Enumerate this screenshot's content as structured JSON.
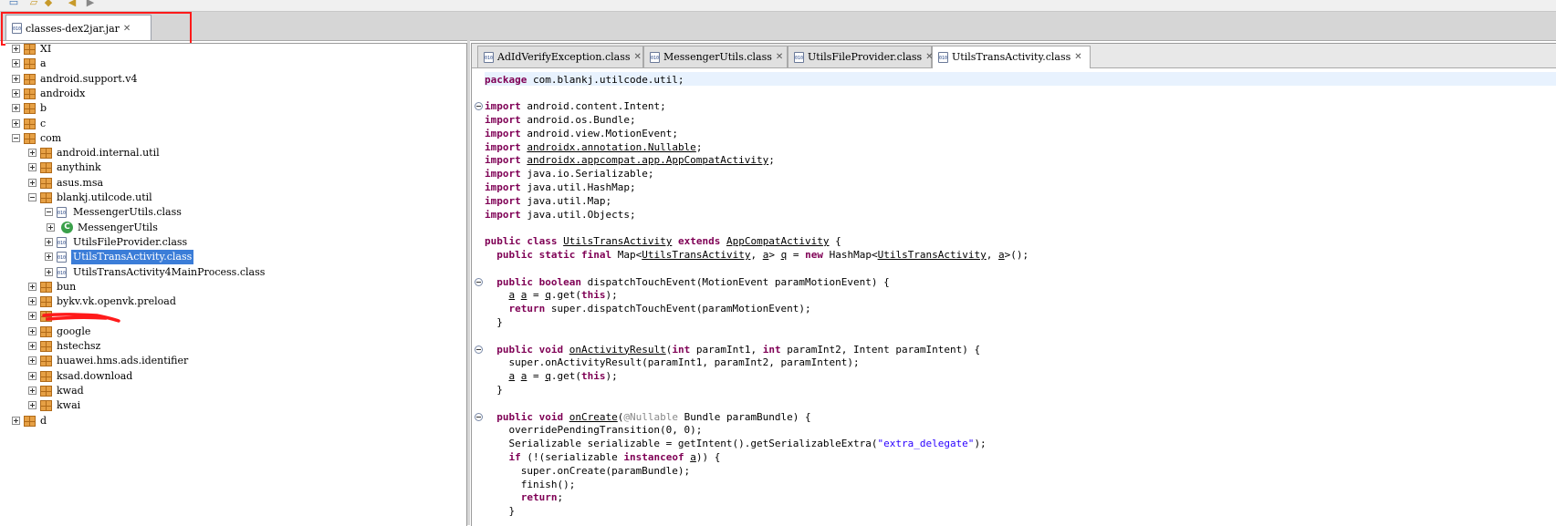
{
  "file_tab": {
    "title": "classes-dex2jar.jar",
    "icon": "class-file-icon"
  },
  "tree": {
    "rows": [
      {
        "label": "XI",
        "depth": 0
      },
      {
        "label": "a",
        "depth": 0
      },
      {
        "label": "android.support.v4",
        "depth": 0
      },
      {
        "label": "androidx",
        "depth": 0
      },
      {
        "label": "b",
        "depth": 0
      },
      {
        "label": "c",
        "depth": 0
      },
      {
        "label": "com",
        "depth": 0,
        "expanded": true
      },
      {
        "label": "android.internal.util",
        "depth": 1
      },
      {
        "label": "anythink",
        "depth": 1
      },
      {
        "label": "asus.msa",
        "depth": 1
      },
      {
        "label": "blankj.utilcode.util",
        "depth": 1,
        "expanded": true
      },
      {
        "label": "MessengerUtils.class",
        "depth": 2,
        "expanded": true,
        "kind": "class"
      },
      {
        "label": "MessengerUtils",
        "depth": 3,
        "kind": "type"
      },
      {
        "label": "UtilsFileProvider.class",
        "depth": 2,
        "kind": "class"
      },
      {
        "label": "UtilsTransActivity.class",
        "depth": 2,
        "kind": "class",
        "selected": true
      },
      {
        "label": "UtilsTransActivity4MainProcess.class",
        "depth": 2,
        "kind": "class"
      },
      {
        "label": "bun",
        "depth": 1
      },
      {
        "label": "bykv.vk.openvk.preload",
        "depth": 1
      },
      {
        "label": "",
        "depth": 1,
        "redacted": true
      },
      {
        "label": "google",
        "depth": 1
      },
      {
        "label": "hstechsz",
        "depth": 1
      },
      {
        "label": "huawei.hms.ads.identifier",
        "depth": 1
      },
      {
        "label": "ksad.download",
        "depth": 1
      },
      {
        "label": "kwad",
        "depth": 1
      },
      {
        "label": "kwai",
        "depth": 1
      },
      {
        "label": "d",
        "depth": 0
      }
    ]
  },
  "editor": {
    "tabs": [
      {
        "label": "AdIdVerifyException.class",
        "active": false
      },
      {
        "label": "MessengerUtils.class",
        "active": false
      },
      {
        "label": "UtilsFileProvider.class",
        "active": false
      },
      {
        "label": "UtilsTransActivity.class",
        "active": true
      }
    ],
    "code_lines": [
      "package com.blankj.utilcode.util;",
      "",
      "import android.content.Intent;",
      "import android.os.Bundle;",
      "import android.view.MotionEvent;",
      "import androidx.annotation.Nullable;",
      "import androidx.appcompat.app.AppCompatActivity;",
      "import java.io.Serializable;",
      "import java.util.HashMap;",
      "import java.util.Map;",
      "import java.util.Objects;",
      "",
      "public class UtilsTransActivity extends AppCompatActivity {",
      "  public static final Map<UtilsTransActivity, a> q = new HashMap<UtilsTransActivity, a>();",
      "",
      "  public boolean dispatchTouchEvent(MotionEvent paramMotionEvent) {",
      "    a a = q.get(this);",
      "    return super.dispatchTouchEvent(paramMotionEvent);",
      "  }",
      "",
      "  public void onActivityResult(int paramInt1, int paramInt2, Intent paramIntent) {",
      "    super.onActivityResult(paramInt1, paramInt2, paramIntent);",
      "    a a = q.get(this);",
      "  }",
      "",
      "  public void onCreate(@Nullable Bundle paramBundle) {",
      "    overridePendingTransition(0, 0);",
      "    Serializable serializable = getIntent().getSerializableExtra(\"extra_delegate\");",
      "    if (!(serializable instanceof a)) {",
      "      super.onCreate(paramBundle);",
      "      finish();",
      "      return;",
      "    }"
    ]
  },
  "colors": {
    "keyword": "#7f0055",
    "string": "#2a00ff",
    "selection": "#3b7dd8",
    "highlight_box": "#ff1a1a",
    "annotation": "#8a8a8a"
  }
}
